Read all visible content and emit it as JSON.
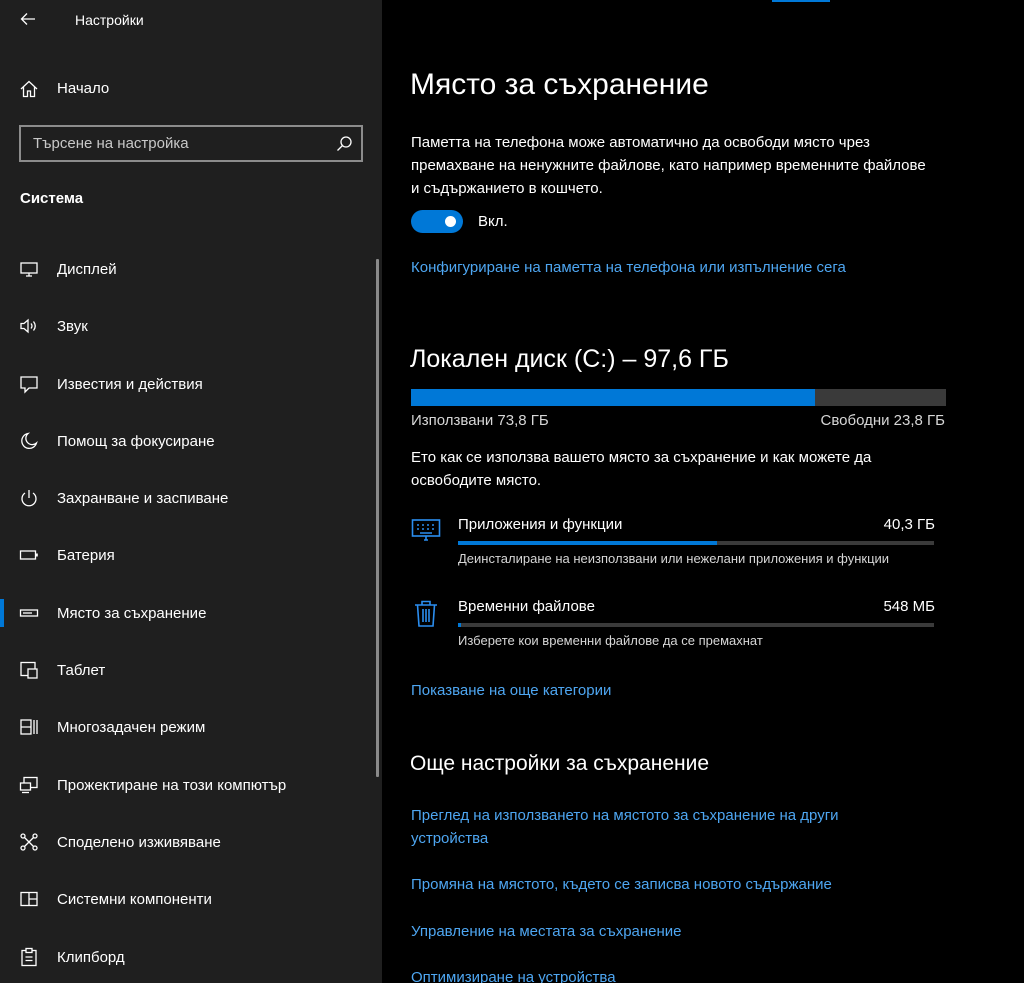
{
  "window": {
    "title": "Настройки"
  },
  "sidebar": {
    "home_label": "Начало",
    "search_placeholder": "Търсене на настройка",
    "section_title": "Система",
    "items": [
      {
        "label": "Дисплей",
        "icon": "display-icon"
      },
      {
        "label": "Звук",
        "icon": "speaker-icon"
      },
      {
        "label": "Известия и действия",
        "icon": "notification-icon"
      },
      {
        "label": "Помощ за фокусиране",
        "icon": "moon-icon"
      },
      {
        "label": "Захранване и заспиване",
        "icon": "power-icon"
      },
      {
        "label": "Батерия",
        "icon": "battery-icon"
      },
      {
        "label": "Място за съхранение",
        "icon": "storage-icon",
        "selected": true
      },
      {
        "label": "Таблет",
        "icon": "tablet-icon"
      },
      {
        "label": "Многозадачен режим",
        "icon": "multitask-icon"
      },
      {
        "label": "Прожектиране на този компютър",
        "icon": "projecting-icon"
      },
      {
        "label": "Споделено изживяване",
        "icon": "shared-experience-icon"
      },
      {
        "label": "Системни компоненти",
        "icon": "components-icon"
      },
      {
        "label": "Клипборд",
        "icon": "clipboard-icon"
      }
    ]
  },
  "main": {
    "title": "Място за съхранение",
    "description": "Паметта на телефона може автоматично да освободи място чрез премахване на ненужните файлове, като например временните файлове и съдържанието в кошчето.",
    "toggle": {
      "state": "Вкл.",
      "on": true
    },
    "configure_link": "Конфигуриране на паметта на телефона или изпълнение сега",
    "disk": {
      "title": "Локален диск (C:) – 97,6 ГБ",
      "used_label": "Използвани 73,8 ГБ",
      "free_label": "Свободни 23,8 ГБ",
      "used_fraction": 0.756
    },
    "usage_description": "Ето как се използва вашето място за съхранение и как можете да освободите място.",
    "categories": [
      {
        "name": "Приложения и функции",
        "size": "40,3 ГБ",
        "subtitle": "Деинсталиране на неизползвани или нежелани приложения и функции",
        "fraction": 0.545,
        "icon": "keyboard-icon"
      },
      {
        "name": "Временни файлове",
        "size": "548 МБ",
        "subtitle": "Изберете кои временни файлове да се премахнат",
        "fraction": 0.007,
        "icon": "trash-icon"
      }
    ],
    "show_more_link": "Показване на още категории",
    "more_settings_title": "Още настройки за съхранение",
    "more_links": [
      "Преглед на използването на мястото за съхранение на други устройства",
      "Промяна на мястото, където се записва новото съдържание",
      "Управление на местата за съхранение",
      "Оптимизиране на устройства"
    ]
  },
  "colors": {
    "accent": "#0078d7",
    "link": "#4ea6f1",
    "sidebar_bg": "#1f1f1f",
    "main_bg": "#000000"
  }
}
